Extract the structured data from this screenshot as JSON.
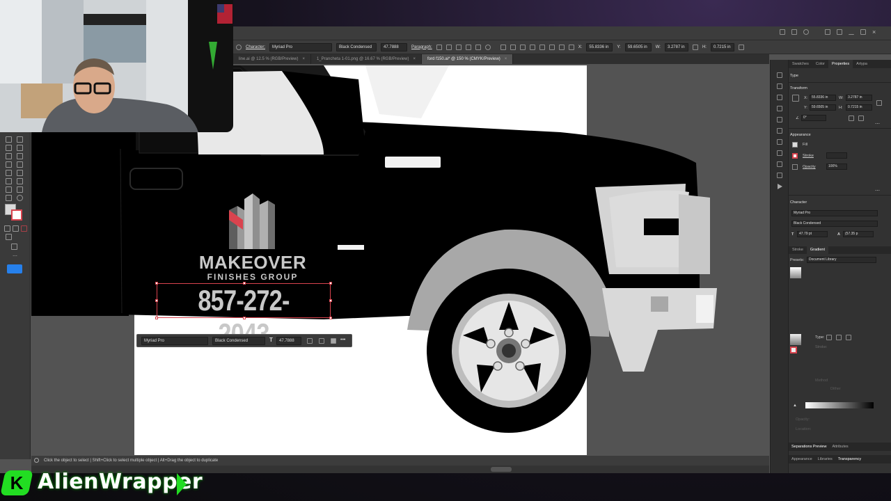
{
  "app": {
    "colors": {
      "ui_dark": "#3c3c3c",
      "ui_mid": "#535353",
      "accent_green": "#33ff33",
      "selection_red": "#d9434e"
    },
    "control_bar": {
      "character_label": "Character:",
      "font_family": "Myriad Pro",
      "font_style": "Black Condensed",
      "font_size": "47.7888",
      "paragraph_label": "Paragraph:",
      "x_label": "X:",
      "x_value": "55.8336 in",
      "y_label": "Y:",
      "y_value": "59.6505 in",
      "w_label": "W:",
      "w_value": "3.2787 in",
      "h_label": "H:",
      "h_value": "0.7215 in"
    },
    "tabs": [
      {
        "label": "line.ai @ 12.5 % (RGB/Preview)"
      },
      {
        "label": "1_Prancheta 1-01.png @ 16.67 % (RGB/Preview)"
      },
      {
        "label": "ford f150.ai* @ 150 % (CMYK/Preview)"
      }
    ],
    "tab_close": "×",
    "status_text": "Click the object to select  |  Shift+Click to select multiple object  |  Alt+Drag the object to duplicate",
    "float_toolbar": {
      "font_family": "Myriad Pro",
      "font_style": "Black Condensed",
      "font_size": "47.7888",
      "more": "•••"
    },
    "artwork": {
      "logo_line1": "MAKEOVER",
      "logo_line2": "FINISHES GROUP",
      "phone": "857-272-2043"
    }
  },
  "right_panel": {
    "tabs": [
      "Swatches",
      "Color",
      "Properties",
      "Artypa"
    ],
    "type_label": "Type",
    "transform_label": "Transform",
    "x_label": "X:",
    "x_value": "55.8336 in",
    "y_label": "Y:",
    "y_value": "59.6505 in",
    "w_label": "W:",
    "w_value": "3.2787 in",
    "h_label": "H:",
    "h_value": "0.7215 in",
    "rotate_value": "0°",
    "appearance_label": "Appearance",
    "fill_label": "Fill",
    "stroke_label": "Stroke",
    "opacity_label": "Opacity",
    "opacity_value": "100%",
    "character_label": "Character",
    "font_family": "Myriad Pro",
    "font_style": "Black Condensed",
    "font_size": "47.79 pt",
    "leading": "(57.35 p",
    "gradient_tabs": [
      "Stroke",
      "Gradient"
    ],
    "presets_label": "Presets:",
    "presets_value": "Document Library",
    "type_field_label": "Type:",
    "stroke_field_label": "Stroke:",
    "method_label": "Method",
    "dither_label": "Dither",
    "opacity_field_label": "Opacity:",
    "location_label": "Location:",
    "bottom_tabs_1": [
      "Separations Preview",
      "Attributes"
    ],
    "bottom_tabs_2": [
      "Appearance",
      "Libraries",
      "Transparency"
    ]
  },
  "brand": {
    "name": "AlienWrapper",
    "logo_letter": "K"
  }
}
